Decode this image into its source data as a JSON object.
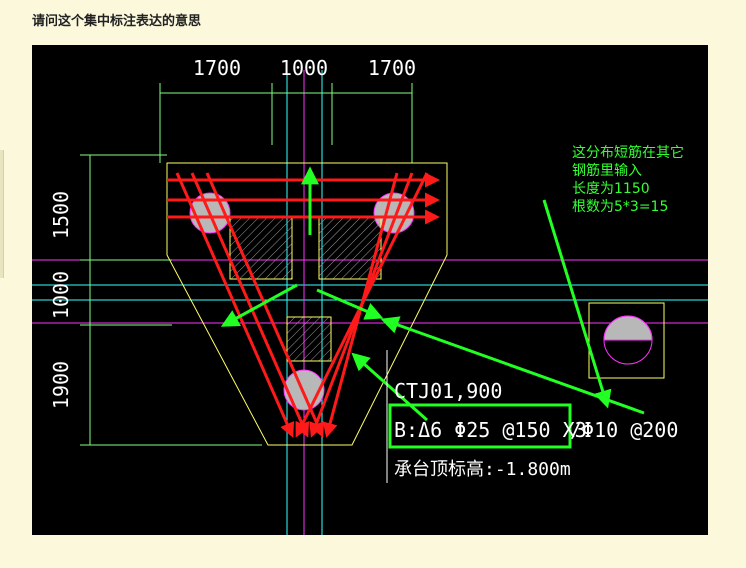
{
  "post": {
    "title": "请问这个集中标注表达的意思"
  },
  "drawing": {
    "dims_top": [
      "1700",
      "1000",
      "1700"
    ],
    "dims_left": [
      "1500",
      "1000",
      "1900"
    ],
    "note_lines": [
      "这分布短筋在其它",
      "钢筋里输入",
      "长度为1150",
      "根数为5*3=15"
    ],
    "label_name": "CTJ01,900",
    "label_rebar_boxed": "B:Δ6 Φ25 @150 X3",
    "label_rebar_rest": "/Φ10 @200",
    "label_elev": "承台顶标高:-1.800m"
  },
  "colors": {
    "page_bg": "#fbf8dc",
    "cad_bg": "#000000",
    "outline": "#ffff66",
    "rebar": "#ff1a1a",
    "annotation": "#22ff22",
    "dim_line": "#7fff7f",
    "axis_cyan": "#33ffff",
    "axis_magenta": "#ff33ff"
  }
}
